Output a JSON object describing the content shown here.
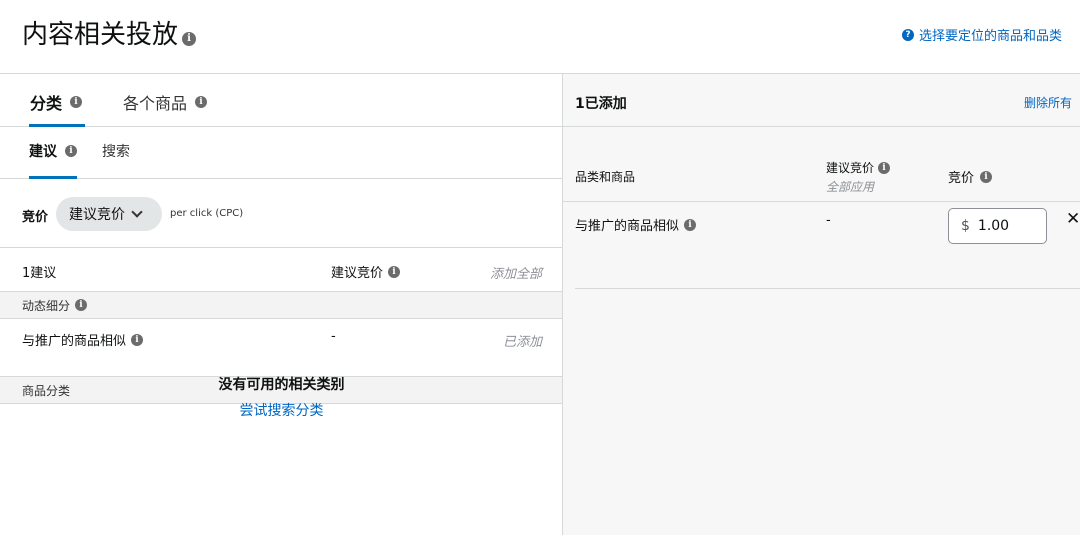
{
  "header": {
    "title": "内容相关投放",
    "help_link": "选择要定位的商品和品类"
  },
  "left": {
    "tabs": [
      {
        "label": "分类",
        "active": true
      },
      {
        "label": "各个商品",
        "active": false
      }
    ],
    "subtabs": [
      {
        "label": "建议",
        "active": true
      },
      {
        "label": "搜索",
        "active": false
      }
    ],
    "bid": {
      "label": "竞价",
      "select_value": "建议竞价",
      "per_click": "per click (CPC)"
    },
    "suggestions": {
      "count_label": "1建议",
      "bid_column": "建议竞价",
      "add_all": "添加全部",
      "sections": [
        {
          "title": "动态细分",
          "items": [
            {
              "name": "与推广的商品相似",
              "bid": "-",
              "status": "已添加"
            }
          ]
        },
        {
          "title": "商品分类",
          "items": []
        }
      ],
      "empty_title": "没有可用的相关类别",
      "empty_link": "尝试搜索分类"
    }
  },
  "right": {
    "count_label": "1已添加",
    "remove_all": "删除所有",
    "columns": {
      "name": "品类和商品",
      "suggested": "建议竞价",
      "apply_all": "全部应用",
      "bid": "竞价"
    },
    "items": [
      {
        "name": "与推广的商品相似",
        "suggested": "-",
        "currency": "$",
        "bid_value": "1.00"
      }
    ]
  },
  "icons": {
    "info": "info-icon",
    "help": "question-circle-icon",
    "chevron": "chevron-down-icon",
    "close": "close-icon"
  },
  "colors": {
    "link": "#0066c0",
    "active_tab_underline": "#0073bb",
    "muted_text": "#8d9096"
  }
}
